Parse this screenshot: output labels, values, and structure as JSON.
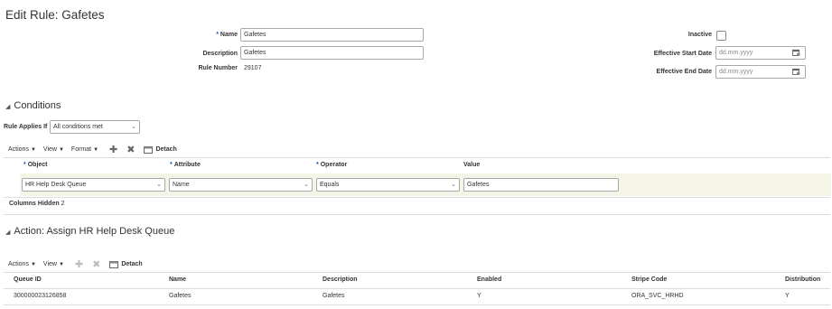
{
  "page": {
    "title": "Edit Rule: Gafetes"
  },
  "form": {
    "name_label": "Name",
    "name_value": "Gafetes",
    "description_label": "Description",
    "description_value": "Gafetes",
    "rule_number_label": "Rule Number",
    "rule_number_value": "29107",
    "inactive_label": "Inactive",
    "start_date_label": "Effective Start Date",
    "start_date_placeholder": "dd.mm.yyyy",
    "end_date_label": "Effective End Date",
    "end_date_placeholder": "dd.mm.yyyy"
  },
  "conditions": {
    "title": "Conditions",
    "applies_label": "Rule Applies If",
    "applies_value": "All conditions met",
    "toolbar": {
      "actions": "Actions",
      "view": "View",
      "format": "Format",
      "detach": "Detach"
    },
    "columns": {
      "object": "Object",
      "attribute": "Attribute",
      "operator": "Operator",
      "value": "Value"
    },
    "row": {
      "object": "HR Help Desk Queue",
      "attribute": "Name",
      "operator": "Equals",
      "value": "Gafetes"
    },
    "columns_hidden_label": "Columns Hidden",
    "columns_hidden_count": "2"
  },
  "action": {
    "title": "Action: Assign HR Help Desk Queue",
    "toolbar": {
      "actions": "Actions",
      "view": "View",
      "detach": "Detach"
    },
    "columns": [
      "Queue ID",
      "Name",
      "Description",
      "Enabled",
      "Stripe Code",
      "Distribution"
    ],
    "rows": [
      [
        "300000023126858",
        "Gafetes",
        "Gafetes",
        "Y",
        "ORA_SVC_HRHD",
        "Y"
      ]
    ]
  },
  "colors": {
    "required": "#1a56a6",
    "row_highlight": "#f4f5e6",
    "border": "#a9a9a9"
  }
}
